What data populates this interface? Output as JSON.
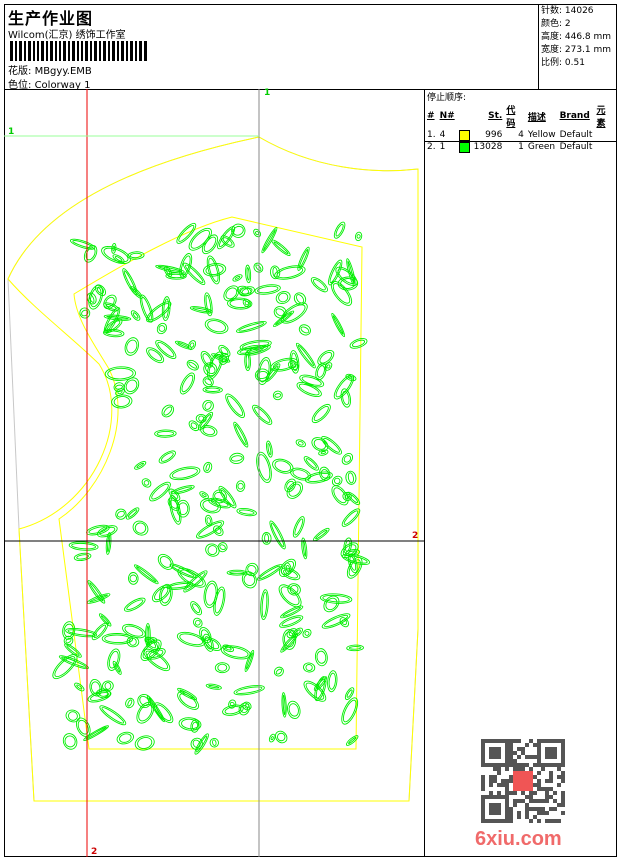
{
  "header": {
    "title": "生产作业图",
    "company": "Wilcom(汇京) 绣饰工作室",
    "design_label": "花版:",
    "design_value": "MBgyy.EMB",
    "colorway_label": "色位:",
    "colorway_value": "Colorway 1"
  },
  "stats": {
    "stitches": "针数: 14026",
    "colors": "颜色: 2",
    "height": "高度: 446.8 mm",
    "width": "宽度: 273.1 mm",
    "scale": "比例: 0.51"
  },
  "stop_sequence": {
    "caption": "停止顺序:",
    "columns": [
      "#",
      "N#",
      "",
      "St.",
      "代码",
      "描述",
      "Brand",
      "元素"
    ],
    "rows": [
      {
        "index": "1.",
        "n": "4",
        "color": "#ffff00",
        "stitches": "996",
        "code": "4",
        "desc": "Yellow",
        "brand": "Default"
      },
      {
        "index": "2.",
        "n": "1",
        "color": "#00ff00",
        "stitches": "13028",
        "code": "1",
        "desc": "Green",
        "brand": "Default"
      }
    ]
  },
  "markers": {
    "one": "1",
    "two": "2"
  },
  "watermark": "6xiu.com",
  "colors": {
    "yellow": "#ffff00",
    "green": "#00ff00",
    "red": "#ff0000",
    "gray": "#c0c0c0"
  }
}
